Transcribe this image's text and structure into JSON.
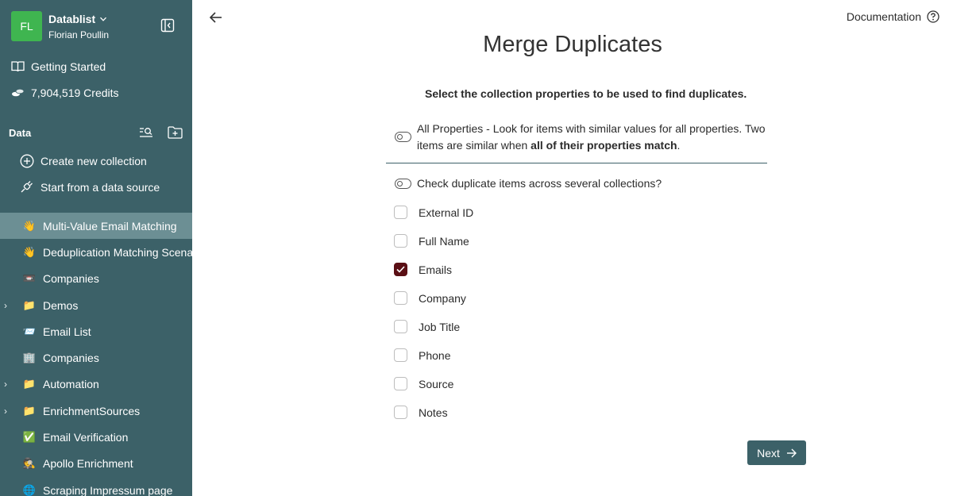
{
  "workspace": {
    "initials": "FL",
    "name": "Datablist",
    "user": "Florian Poullin"
  },
  "sidebar": {
    "getting_started": "Getting Started",
    "credits": "7,904,519 Credits",
    "data_heading": "Data",
    "create_collection": "Create new collection",
    "start_source": "Start from a data source",
    "items": [
      {
        "label": "Multi-Value Email Matching",
        "icon": "👋",
        "active": true,
        "expandable": false
      },
      {
        "label": "Deduplication Matching Scenarios",
        "icon": "👋",
        "active": false,
        "expandable": false
      },
      {
        "label": "Companies",
        "icon": "📼",
        "active": false,
        "expandable": false
      },
      {
        "label": "Demos",
        "icon": "📁",
        "active": false,
        "expandable": true
      },
      {
        "label": "Email List",
        "icon": "📨",
        "active": false,
        "expandable": false
      },
      {
        "label": "Companies",
        "icon": "🏢",
        "active": false,
        "expandable": false
      },
      {
        "label": "Automation",
        "icon": "📁",
        "active": false,
        "expandable": true
      },
      {
        "label": "EnrichmentSources",
        "icon": "📁",
        "active": false,
        "expandable": true
      },
      {
        "label": "Email Verification",
        "icon": "✅",
        "active": false,
        "expandable": false
      },
      {
        "label": "Apollo Enrichment",
        "icon": "🕵",
        "active": false,
        "expandable": false
      },
      {
        "label": "Scraping Impressum page",
        "icon": "🌐",
        "active": false,
        "expandable": false
      }
    ]
  },
  "header": {
    "documentation": "Documentation"
  },
  "main": {
    "title": "Merge Duplicates",
    "subtitle": "Select the collection properties to be used to find duplicates.",
    "all_properties_text": "All Properties - Look for items with similar values for all properties. Two items are similar when ",
    "all_properties_bold": "all of their properties match",
    "all_properties_end": ".",
    "cross_collections": "Check duplicate items across several collections?",
    "properties": [
      {
        "label": "External ID",
        "checked": false
      },
      {
        "label": "Full Name",
        "checked": false
      },
      {
        "label": "Emails",
        "checked": true
      },
      {
        "label": "Company",
        "checked": false
      },
      {
        "label": "Job Title",
        "checked": false
      },
      {
        "label": "Phone",
        "checked": false
      },
      {
        "label": "Source",
        "checked": false
      },
      {
        "label": "Notes",
        "checked": false
      }
    ],
    "next_label": "Next"
  },
  "colors": {
    "sidebar": "#3c6168",
    "active_item": "#6c8f94",
    "avatar": "#3fb550",
    "checked": "#5a0f15"
  }
}
